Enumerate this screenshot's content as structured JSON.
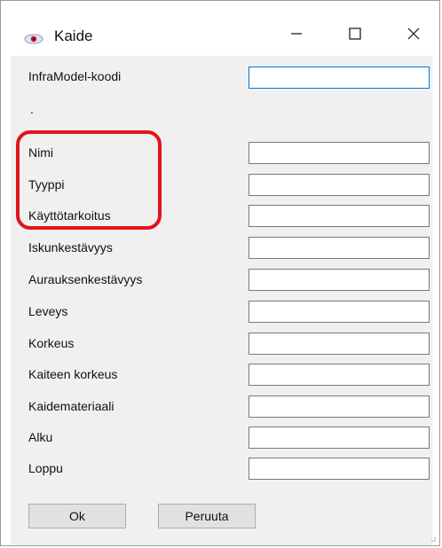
{
  "window": {
    "title": "Kaide",
    "icon": "eye-icon",
    "controls": [
      "minimize-icon",
      "maximize-icon",
      "close-icon"
    ]
  },
  "form": {
    "infra_label": "InfraModel-koodi",
    "infra_value": "",
    "separator": ".",
    "fields": [
      {
        "label": "Nimi",
        "value": ""
      },
      {
        "label": "Tyyppi",
        "value": ""
      },
      {
        "label": "Käyttötarkoitus",
        "value": ""
      },
      {
        "label": "Iskunkestävyys",
        "value": ""
      },
      {
        "label": "Aurauksenkestävyys",
        "value": ""
      },
      {
        "label": "Leveys",
        "value": ""
      },
      {
        "label": "Korkeus",
        "value": ""
      },
      {
        "label": "Kaiteen korkeus",
        "value": ""
      },
      {
        "label": "Kaidemateriaali",
        "value": ""
      },
      {
        "label": "Alku",
        "value": ""
      },
      {
        "label": "Loppu",
        "value": ""
      }
    ]
  },
  "buttons": {
    "ok": "Ok",
    "cancel": "Peruuta"
  },
  "colors": {
    "highlight": "#e0141c",
    "focus_border": "#0078d7",
    "client_bg": "#f0f0f0"
  }
}
